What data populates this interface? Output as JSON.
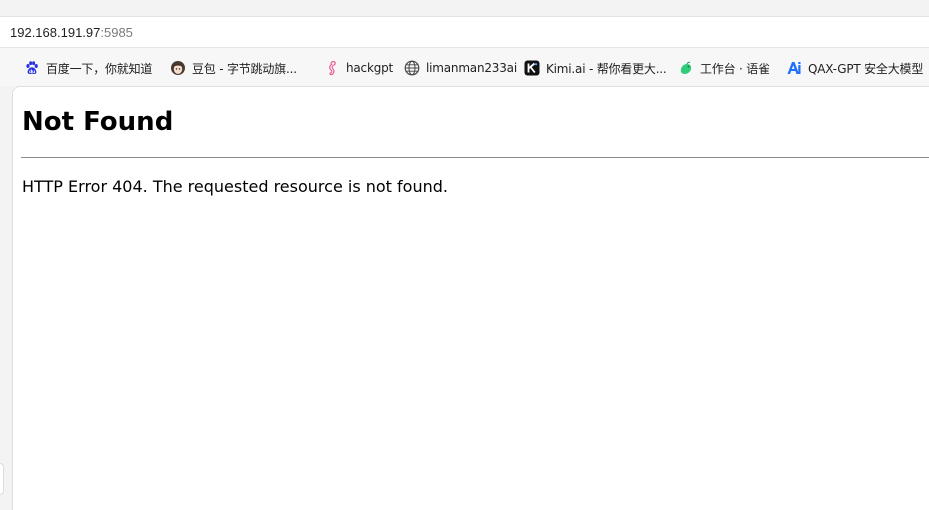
{
  "address_bar": {
    "host": "192.168.191.97",
    "port": ":5985"
  },
  "bookmarks": [
    {
      "label": "百度一下，你就知道",
      "icon": "baidu-paw-icon"
    },
    {
      "label": "豆包 - 字节跳动旗...",
      "icon": "doubao-avatar-icon"
    },
    {
      "label": "hackgpt",
      "icon": "seahorse-icon"
    },
    {
      "label": "limanman233ai",
      "icon": "globe-icon"
    },
    {
      "label": "Kimi.ai - 帮你看更大...",
      "icon": "kimi-k-icon"
    },
    {
      "label": "工作台 · 语雀",
      "icon": "yuque-bird-icon"
    },
    {
      "label": "QAX-GPT 安全大模型",
      "icon": "qax-ai-icon"
    }
  ],
  "page": {
    "heading": "Not Found",
    "message": "HTTP Error 404. The requested resource is not found."
  },
  "colors": {
    "baidu": "#2932e1",
    "hackgpt": "#e8609a",
    "yuque": "#31cc7a",
    "qax": "#1f6fff"
  }
}
